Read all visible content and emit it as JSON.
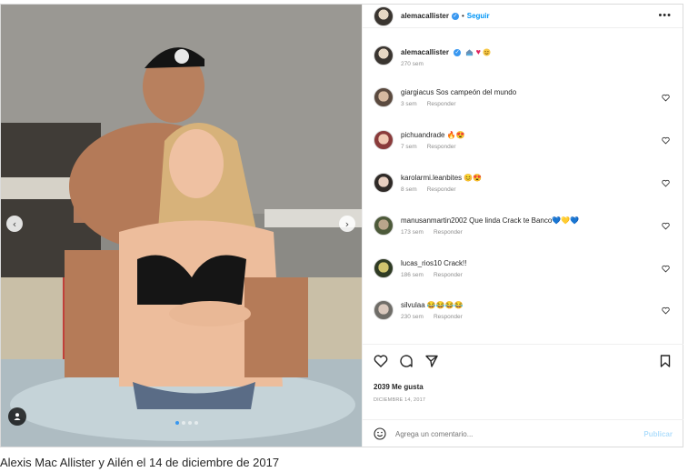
{
  "post": {
    "username": "alemacallister",
    "follow_label": "Seguir",
    "more_label": "•••",
    "separator": "•",
    "caption": {
      "username": "alemacallister",
      "text": "",
      "emoji_icons": [
        "house-pool-icon",
        "red-heart-icon",
        "smiling-face-icon"
      ],
      "time": "270 sem"
    },
    "comments": [
      {
        "username": "giargiacus",
        "text": "Sos campeón del mundo",
        "time": "3 sem",
        "reply": "Responder"
      },
      {
        "username": "pichuandrade",
        "text": "🔥😍",
        "time": "7 sem",
        "reply": "Responder"
      },
      {
        "username": "karolarmi.leanbites",
        "text": "😊😍",
        "time": "8 sem",
        "reply": "Responder"
      },
      {
        "username": "manusanmartin2002",
        "text": "Que linda Crack te Banco💙💛💙",
        "time": "173 sem",
        "reply": "Responder"
      },
      {
        "username": "lucas_rios10",
        "text": "Crack!!",
        "time": "186 sem",
        "reply": "Responder"
      },
      {
        "username": "silvulaa",
        "text": "😂😂😂😂",
        "time": "230 sem",
        "reply": "Responder"
      }
    ],
    "likes": "2039 Me gusta",
    "date": "DICIEMBRE 14, 2017",
    "comment_placeholder": "Agrega un comentario...",
    "publish_label": "Publicar",
    "carousel": {
      "total": 4,
      "active": 1
    }
  },
  "colors": {
    "accent": "#0095f6",
    "publish_disabled": "#b2dffc",
    "verified": "#3897f0"
  },
  "figure_caption": "Alexis Mac Allister y Ailén el 14 de diciembre de 2017"
}
